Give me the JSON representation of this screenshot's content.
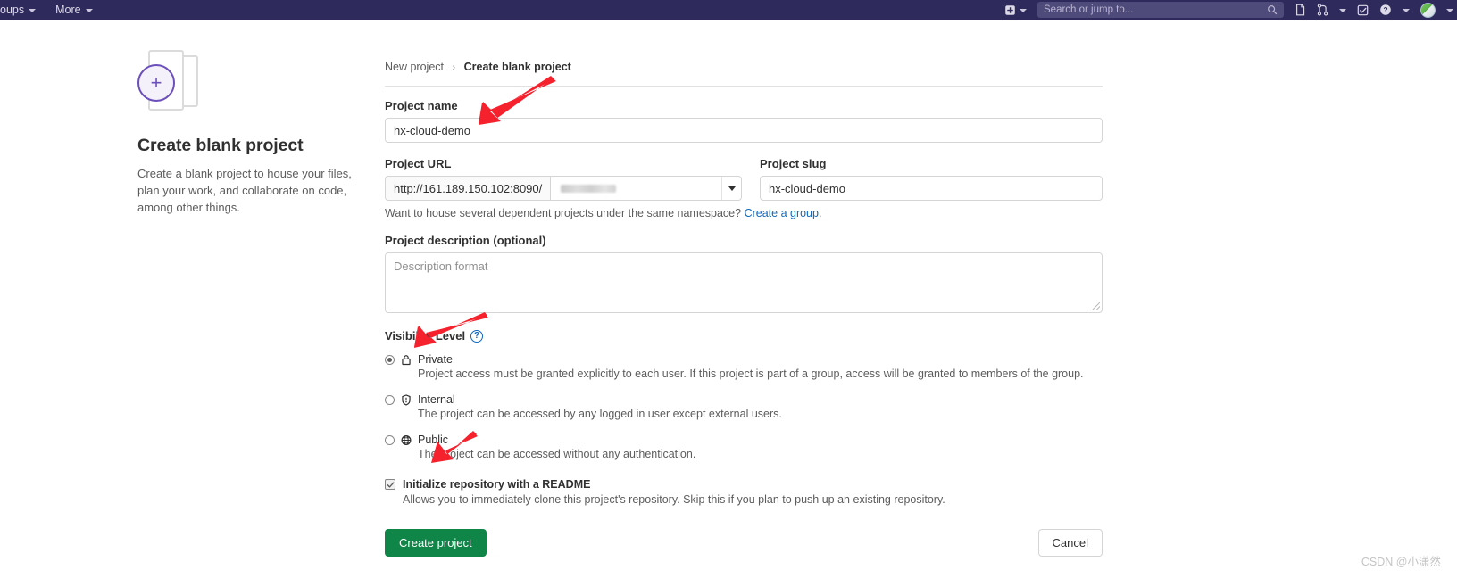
{
  "topnav": {
    "left_items": [
      {
        "label": "oups",
        "has_caret": true
      },
      {
        "label": "More",
        "has_caret": true
      }
    ],
    "search": {
      "placeholder": "Search or jump to...",
      "value": ""
    },
    "icons": [
      "plus-square-icon",
      "chevron-down-icon",
      "issues-icon",
      "merge-request-icon",
      "chevron-down-icon",
      "todos-icon",
      "help-icon",
      "chevron-down-icon",
      "avatar",
      "chevron-down-icon"
    ],
    "colors": {
      "bar_bg": "#2e2a5b",
      "search_bg": "#4e4a7a"
    }
  },
  "left_panel": {
    "icon_name": "blank-project-icon",
    "title": "Create blank project",
    "description": "Create a blank project to house your files, plan your work, and collaborate on code, among other things.",
    "accent": "#6b4fbb"
  },
  "breadcrumb": {
    "parent": "New project",
    "separator": "›",
    "current": "Create blank project"
  },
  "form": {
    "project_name": {
      "label": "Project name",
      "value": "hx-cloud-demo",
      "placeholder": ""
    },
    "project_url": {
      "label": "Project URL",
      "prefix": "http://161.189.150.102:8090/",
      "namespace_value": "",
      "namespace_redacted": true
    },
    "project_slug": {
      "label": "Project slug",
      "value": "hx-cloud-demo",
      "placeholder": ""
    },
    "namespace_help": {
      "text": "Want to house several dependent projects under the same namespace?",
      "link_text": "Create a group",
      "link_suffix": ".",
      "link_color": "#1068bf"
    },
    "project_description": {
      "label": "Project description (optional)",
      "value": "",
      "placeholder": "Description format"
    },
    "visibility": {
      "label": "Visibility Level",
      "help_icon": "question-mark-icon",
      "selected": "private",
      "options": [
        {
          "id": "private",
          "icon": "lock-icon",
          "name": "Private",
          "description": "Project access must be granted explicitly to each user. If this project is part of a group, access will be granted to members of the group.",
          "selected": true
        },
        {
          "id": "internal",
          "icon": "shield-icon",
          "name": "Internal",
          "description": "The project can be accessed by any logged in user except external users.",
          "selected": false
        },
        {
          "id": "public",
          "icon": "globe-icon",
          "name": "Public",
          "description": "The project can be accessed without any authentication.",
          "selected": false
        }
      ]
    },
    "readme": {
      "label": "Initialize repository with a README",
      "description": "Allows you to immediately clone this project's repository. Skip this if you plan to push up an existing repository.",
      "checked": true
    },
    "buttons": {
      "create_label": "Create project",
      "create_color": "#108548",
      "cancel_label": "Cancel"
    }
  },
  "annotations": {
    "arrow_color": "#f5222d",
    "arrows": [
      {
        "name": "arrow-to-project-name",
        "target": "project-name-input"
      },
      {
        "name": "arrow-to-private-option",
        "target": "visibility-private-radio"
      },
      {
        "name": "arrow-to-readme-checkbox",
        "target": "readme-checkbox"
      }
    ]
  },
  "watermark": {
    "text": "CSDN @小潇然"
  }
}
